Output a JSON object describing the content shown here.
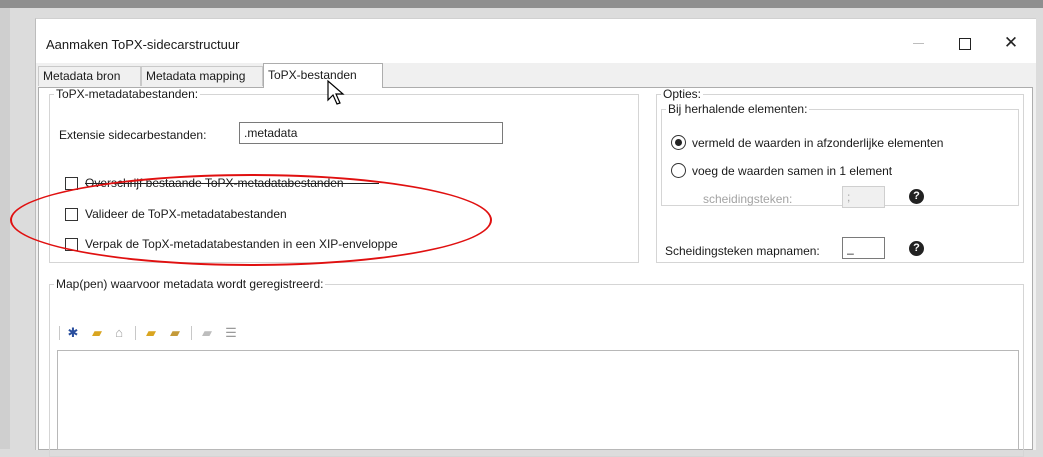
{
  "window": {
    "title": "Aanmaken ToPX-sidecarstructuur",
    "controls": {
      "minimize": "—",
      "maximize": "☐",
      "close": "✕"
    }
  },
  "tabs": [
    {
      "label": "Metadata bron",
      "selected": false
    },
    {
      "label": "Metadata mapping",
      "selected": false
    },
    {
      "label": "ToPX-bestanden",
      "selected": true
    }
  ],
  "topx_group": {
    "legend": "ToPX-metadatabestanden:",
    "extension_label": "Extensie sidecarbestanden:",
    "extension_value": ".metadata",
    "checkboxes": [
      {
        "label": "Overschrijf bestaande ToPX-metadatabestanden",
        "checked": false
      },
      {
        "label": "Valideer de ToPX-metadatabestanden",
        "checked": false
      },
      {
        "label": "Verpak de TopX-metadatabestanden in een XIP-enveloppe",
        "checked": false
      }
    ]
  },
  "options_group": {
    "legend": "Opties:",
    "repeat_legend": "Bij herhalende elementen:",
    "radios": [
      {
        "label": "vermeld de waarden in afzonderlijke elementen",
        "selected": true
      },
      {
        "label": "voeg de waarden samen in 1 element",
        "selected": false
      }
    ],
    "separator_label": "scheidingsteken:",
    "separator_value": ";",
    "folder_separator_label": "Scheidingsteken mapnamen:",
    "folder_separator_value": "_",
    "help_glyph": "?"
  },
  "map_group": {
    "legend": "Map(pen) waarvoor metadata wordt geregistreerd:",
    "toolbar": [
      {
        "icon": "add-star-icon",
        "glyph": "✱",
        "color": "#2a4f9e",
        "enabled": true
      },
      {
        "icon": "folder-up-icon",
        "glyph": "▰",
        "color": "#d9a520",
        "enabled": true
      },
      {
        "icon": "home-icon",
        "glyph": "⌂",
        "color": "#a0a0a0",
        "enabled": false
      },
      {
        "icon": "add-folder-icon",
        "glyph": "▰",
        "color": "#d9a520",
        "enabled": true
      },
      {
        "icon": "browse-folder-icon",
        "glyph": "▰",
        "color": "#c49a3a",
        "enabled": true
      },
      {
        "icon": "remove-folder-icon",
        "glyph": "▰",
        "color": "#bdbdbd",
        "enabled": false
      },
      {
        "icon": "list-icon",
        "glyph": "☰",
        "color": "#9a9a9a",
        "enabled": false
      }
    ]
  },
  "colors": {
    "annotation": "#e01010",
    "window_bg": "#f0f0f0"
  }
}
